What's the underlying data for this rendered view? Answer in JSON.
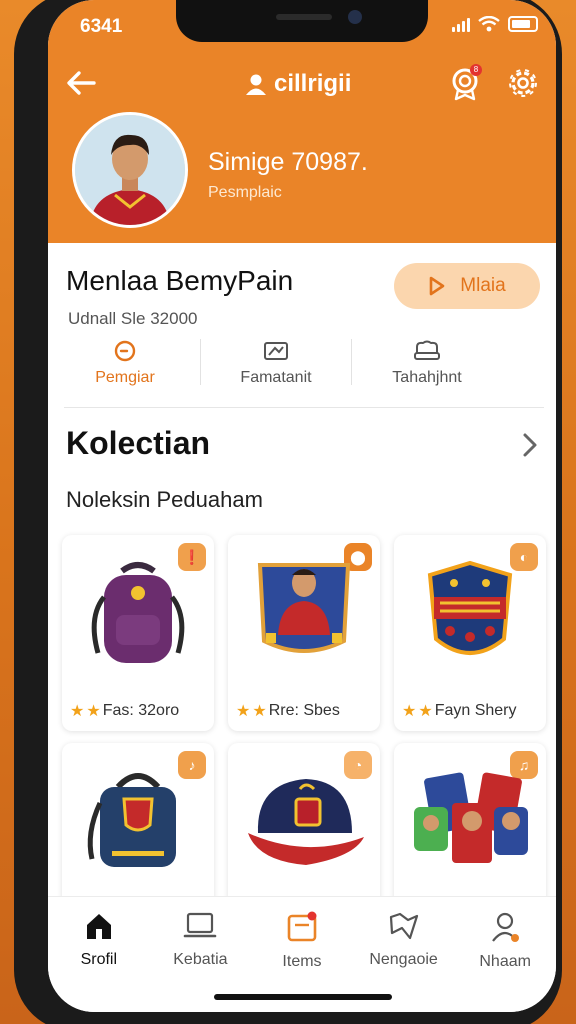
{
  "status": {
    "time": "6341"
  },
  "header": {
    "title": "cillrigii",
    "notification_count": "8"
  },
  "profile": {
    "name": "Simige 70987.",
    "subtitle": "Pesmplaic"
  },
  "membership": {
    "title": "Menlaa BemyPain",
    "subtitle": "Udnall Sle 32000",
    "action_label": "Mlaia"
  },
  "stats": [
    {
      "label": "Pemgiar",
      "icon": "clock-icon",
      "active": true
    },
    {
      "label": "Famatanit",
      "icon": "ticket-icon",
      "active": false
    },
    {
      "label": "Tahahjhnt",
      "icon": "hat-icon",
      "active": false
    }
  ],
  "collection": {
    "title": "Kolectian",
    "subtitle": "Noleksin Peduaham",
    "items": [
      {
        "name": "backpack",
        "caption": "Fas: 32oro",
        "stars": 2
      },
      {
        "name": "player-card",
        "caption": "Rre: Sbes",
        "stars": 2
      },
      {
        "name": "club-patch",
        "caption": "Fayn Shery",
        "stars": 2
      },
      {
        "name": "shoulder-bag",
        "caption": "",
        "stars": 0
      },
      {
        "name": "cap",
        "caption": "",
        "stars": 0
      },
      {
        "name": "sticker-cards",
        "caption": "",
        "stars": 0
      }
    ]
  },
  "nav": [
    {
      "label": "Srofil",
      "icon": "home-icon",
      "active": true
    },
    {
      "label": "Kebatia",
      "icon": "laptop-icon",
      "active": false
    },
    {
      "label": "Items",
      "icon": "items-icon",
      "active": false
    },
    {
      "label": "Nengaoie",
      "icon": "map-icon",
      "active": false
    },
    {
      "label": "Nhaam",
      "icon": "user-icon",
      "active": false
    }
  ],
  "colors": {
    "accent": "#ea8428",
    "accent_soft": "#fbd6ae",
    "star": "#f2a21a"
  }
}
